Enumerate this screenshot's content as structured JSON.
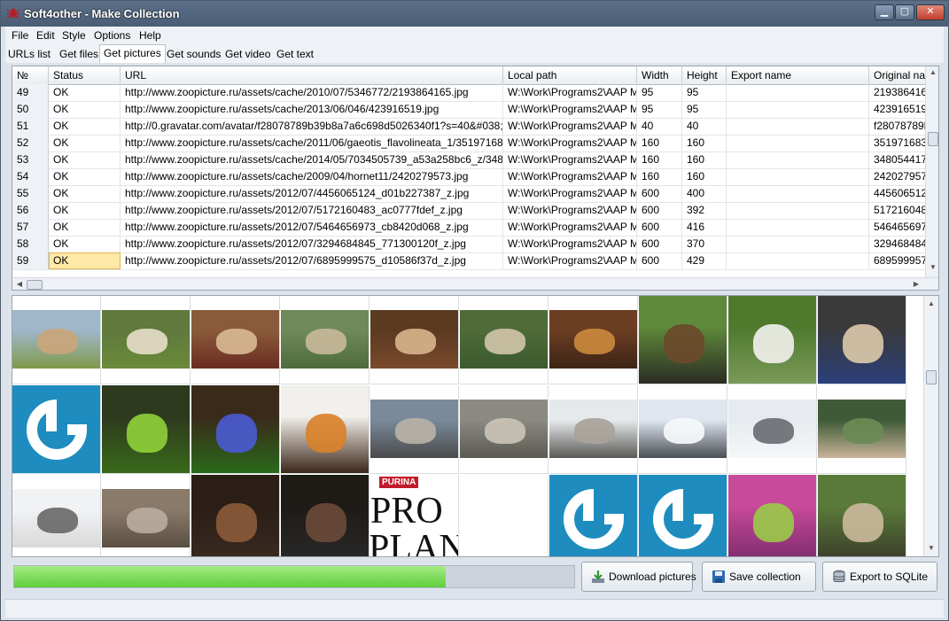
{
  "window": {
    "title": "Soft4other - Make Collection",
    "controls": [
      "minimize-icon",
      "maximize-icon",
      "close-icon"
    ]
  },
  "menu": [
    "File",
    "Edit",
    "Style",
    "Options",
    "Help"
  ],
  "tabs": {
    "items": [
      "URLs list",
      "Get files",
      "Get pictures",
      "Get sounds",
      "Get video",
      "Get text"
    ],
    "active": "Get pictures"
  },
  "grid": {
    "columns": [
      "№",
      "Status",
      "URL",
      "Local path",
      "Width",
      "Height",
      "Export name",
      "Original nan"
    ],
    "rows": [
      [
        "49",
        "OK",
        "http://www.zoopicture.ru/assets/cache/2010/07/5346772/2193864165.jpg",
        "W:\\Work\\Programs2\\AAP Mak",
        "95",
        "95",
        "",
        "219386416"
      ],
      [
        "50",
        "OK",
        "http://www.zoopicture.ru/assets/cache/2013/06/046/423916519.jpg",
        "W:\\Work\\Programs2\\AAP Mak",
        "95",
        "95",
        "",
        "423916519"
      ],
      [
        "51",
        "OK",
        "http://0.gravatar.com/avatar/f28078789b39b8a7a6c698d5026340f1?s=40&#038;d=ht",
        "W:\\Work\\Programs2\\AAP Mak",
        "40",
        "40",
        "",
        "f28078789b"
      ],
      [
        "52",
        "OK",
        "http://www.zoopicture.ru/assets/cache/2011/06/gaeotis_flavolineata_1/3519716836.jpg",
        "W:\\Work\\Programs2\\AAP Mak",
        "160",
        "160",
        "",
        "351971683"
      ],
      [
        "53",
        "OK",
        "http://www.zoopicture.ru/assets/cache/2014/05/7034505739_a53a258bc6_z/3480544",
        "W:\\Work\\Programs2\\AAP Mak",
        "160",
        "160",
        "",
        "348054417"
      ],
      [
        "54",
        "OK",
        "http://www.zoopicture.ru/assets/cache/2009/04/hornet11/2420279573.jpg",
        "W:\\Work\\Programs2\\AAP Mak",
        "160",
        "160",
        "",
        "242027957"
      ],
      [
        "55",
        "OK",
        "http://www.zoopicture.ru/assets/2012/07/4456065124_d01b227387_z.jpg",
        "W:\\Work\\Programs2\\AAP Mak",
        "600",
        "400",
        "",
        "445606512"
      ],
      [
        "56",
        "OK",
        "http://www.zoopicture.ru/assets/2012/07/5172160483_ac0777fdef_z.jpg",
        "W:\\Work\\Programs2\\AAP Mak",
        "600",
        "392",
        "",
        "517216048"
      ],
      [
        "57",
        "OK",
        "http://www.zoopicture.ru/assets/2012/07/5464656973_cb8420d068_z.jpg",
        "W:\\Work\\Programs2\\AAP Mak",
        "600",
        "416",
        "",
        "546465697"
      ],
      [
        "58",
        "OK",
        "http://www.zoopicture.ru/assets/2012/07/3294684845_771300120f_z.jpg",
        "W:\\Work\\Programs2\\AAP Mak",
        "600",
        "370",
        "",
        "329468484"
      ],
      [
        "59",
        "OK",
        "http://www.zoopicture.ru/assets/2012/07/6895999575_d10586f37d_z.jpg",
        "W:\\Work\\Programs2\\AAP Mak",
        "600",
        "429",
        "",
        "689599957"
      ]
    ],
    "selected_row": "59",
    "selected_column": "Status"
  },
  "gallery": {
    "tiles": [
      {
        "name": "dog-on-grass",
        "kind": "photo",
        "colors": [
          "#9fb7c9",
          "#c9a57b",
          "#7f9a4a"
        ]
      },
      {
        "name": "dog-lying-field",
        "kind": "photo",
        "colors": [
          "#5f7a3c",
          "#e4dcc8",
          "#6b8a3a"
        ]
      },
      {
        "name": "dog-with-toy",
        "kind": "photo",
        "colors": [
          "#8a5a3a",
          "#d7b793",
          "#6a2b22"
        ]
      },
      {
        "name": "dog-in-puddle",
        "kind": "photo",
        "colors": [
          "#6f8a5a",
          "#c7b79a",
          "#4e6b3c"
        ]
      },
      {
        "name": "dog-indoors",
        "kind": "photo",
        "colors": [
          "#5b3a22",
          "#d6b38a",
          "#7a4a2a"
        ]
      },
      {
        "name": "dog-on-lawn",
        "kind": "photo",
        "colors": [
          "#4f6b3a",
          "#cfc3a8",
          "#3c5a2e"
        ]
      },
      {
        "name": "dog-on-floor",
        "kind": "photo",
        "colors": [
          "#6b3e22",
          "#c9883d",
          "#3c2416"
        ]
      },
      {
        "name": "german-shepherd",
        "kind": "photo-full",
        "colors": [
          "#5f8a3c",
          "#6b4a2a",
          "#2a2a22"
        ]
      },
      {
        "name": "white-dog-ball",
        "kind": "photo-full",
        "colors": [
          "#4f7a2e",
          "#f0efe9",
          "#7a9a5a"
        ]
      },
      {
        "name": "pug-in-shirt",
        "kind": "photo-full",
        "colors": [
          "#3a3a3a",
          "#d9c7a8",
          "#2a3f7a"
        ]
      },
      {
        "name": "gravatar-logo",
        "kind": "logo",
        "colors": [
          "#1e8cbe",
          "#ffffff",
          "#1e8cbe"
        ]
      },
      {
        "name": "green-slug",
        "kind": "photo-full",
        "colors": [
          "#2e3a1e",
          "#8fce3a",
          "#3a6a1a"
        ]
      },
      {
        "name": "dragonfly",
        "kind": "photo-full",
        "colors": [
          "#3a2a1a",
          "#4a5acf",
          "#2a6a1a"
        ]
      },
      {
        "name": "hornet",
        "kind": "photo-full",
        "colors": [
          "#f2f0ec",
          "#d9822b",
          "#3a2416"
        ]
      },
      {
        "name": "wolf-portrait",
        "kind": "photo",
        "colors": [
          "#7a8a9a",
          "#b7b2a8",
          "#4a4a4a"
        ]
      },
      {
        "name": "wolf-lying",
        "kind": "photo",
        "colors": [
          "#8a8a82",
          "#c9c3b5",
          "#5a5a52"
        ]
      },
      {
        "name": "wolves-snow",
        "kind": "photo",
        "colors": [
          "#e6e9ec",
          "#a8a39a",
          "#5a5a55"
        ]
      },
      {
        "name": "husky-running",
        "kind": "photo",
        "colors": [
          "#dfe6ee",
          "#f6f8fb",
          "#4a4e55"
        ]
      },
      {
        "name": "husky-in-snow",
        "kind": "photo",
        "colors": [
          "#e7ebef",
          "#6a6e73",
          "#f5f7f9"
        ]
      },
      {
        "name": "wolf-in-forest",
        "kind": "photo",
        "colors": [
          "#3e5a36",
          "#6a8a55",
          "#c8b49a"
        ]
      },
      {
        "name": "husky-face",
        "kind": "photo",
        "colors": [
          "#f0f2f4",
          "#6a6a6a",
          "#d9d9d9"
        ]
      },
      {
        "name": "ruins-cats",
        "kind": "photo",
        "colors": [
          "#8a7a6a",
          "#b8ad9e",
          "#5a4e42"
        ]
      },
      {
        "name": "puppy-dark",
        "kind": "photo-full",
        "colors": [
          "#2a1e16",
          "#8a5a3a",
          "#3a2a22"
        ]
      },
      {
        "name": "old-dog",
        "kind": "photo-full",
        "colors": [
          "#1e1a16",
          "#6a4a3a",
          "#2a2a2a"
        ]
      },
      {
        "name": "purina-pro-plan",
        "kind": "purina",
        "colors": [
          "#ffffff",
          "#c21b2b",
          "#111111"
        ]
      },
      {
        "name": "empty-tile",
        "kind": "empty",
        "colors": [
          "#ffffff",
          "#ffffff",
          "#ffffff"
        ]
      },
      {
        "name": "gravatar-logo-2",
        "kind": "logo",
        "colors": [
          "#1e8cbe",
          "#ffffff",
          "#1e8cbe"
        ]
      },
      {
        "name": "gravatar-logo-3",
        "kind": "logo",
        "colors": [
          "#1e8cbe",
          "#ffffff",
          "#1e8cbe"
        ]
      },
      {
        "name": "frog-in-hand",
        "kind": "photo-full",
        "colors": [
          "#c84a9a",
          "#9ac84a",
          "#7a2a6a"
        ]
      },
      {
        "name": "bat-eared-fox",
        "kind": "photo-full",
        "colors": [
          "#5a7a3a",
          "#c9b79a",
          "#3a3a2a"
        ]
      }
    ],
    "purina_text": {
      "brand": "PURINA",
      "line1": "PRO",
      "line2": "PLAN"
    }
  },
  "progress": {
    "value": 0.77
  },
  "buttons": {
    "download": "Download pictures",
    "save": "Save collection",
    "export": "Export to SQLite"
  },
  "colors": {
    "titlebar": "#4a5d75",
    "progress_fill": "#6fd44a",
    "selection": "#ffe9a8",
    "gravatar_blue": "#1e8cbe"
  }
}
